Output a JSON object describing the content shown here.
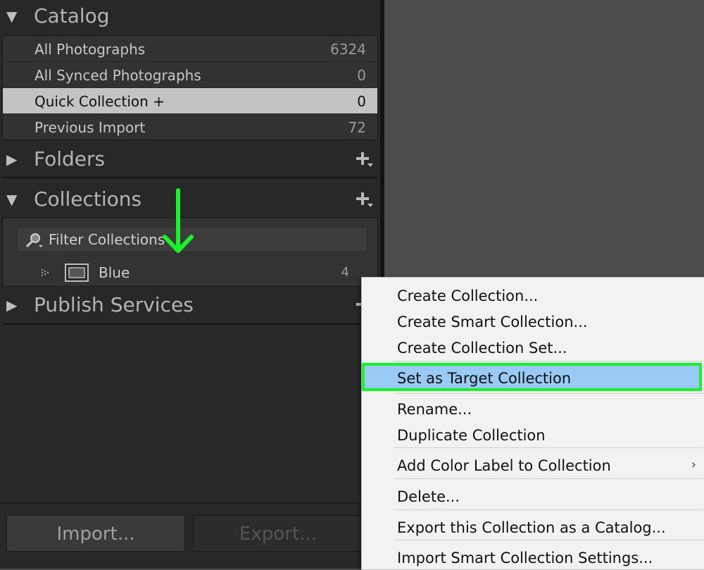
{
  "catalog": {
    "title": "Catalog",
    "items": [
      {
        "label": "All Photographs",
        "count": "6324"
      },
      {
        "label": "All Synced Photographs",
        "count": "0"
      },
      {
        "label": "Quick Collection  +",
        "count": "0"
      },
      {
        "label": "Previous Import",
        "count": "72"
      }
    ]
  },
  "folders": {
    "title": "Folders"
  },
  "collections": {
    "title": "Collections",
    "filter_placeholder": "Filter Collections",
    "items": [
      {
        "label": "Blue",
        "count": "4"
      }
    ]
  },
  "publish": {
    "title": "Publish Services"
  },
  "buttons": {
    "import": "Import...",
    "export": "Export..."
  },
  "context_menu": {
    "items": [
      "Create Collection...",
      "Create Smart Collection...",
      "Create Collection Set...",
      "Set as Target Collection",
      "Rename...",
      "Duplicate Collection",
      "Add Color Label to Collection",
      "Delete...",
      "Export this Collection as a Catalog...",
      "Import Smart Collection Settings..."
    ],
    "submenu_glyph": "›"
  },
  "icons": {
    "expand": "triangle-down-icon",
    "collapse": "triangle-right-icon",
    "add": "plus-icon",
    "search": "magnifier-icon",
    "collection": "collection-icon",
    "annotation": "green-arrow-down"
  },
  "colors": {
    "highlight_fill": "#99c9f5",
    "highlight_outline": "#19f22b",
    "arrow": "#19f22b"
  }
}
